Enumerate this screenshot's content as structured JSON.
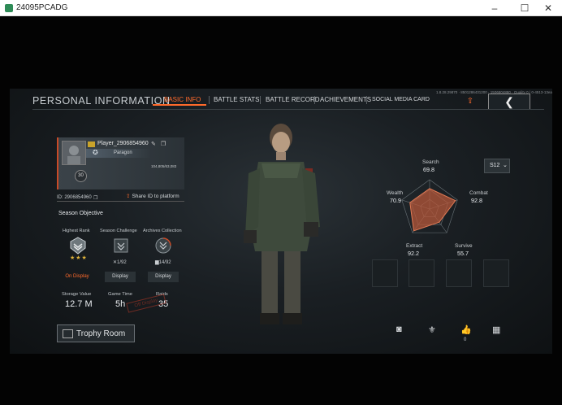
{
  "window": {
    "title": "24095PCADG",
    "minimize": "–",
    "maximize": "☐",
    "close": "✕"
  },
  "header": {
    "title": "PERSONAL INFORMATION",
    "tabs": [
      {
        "label": "BASIC INFO",
        "active": true
      },
      {
        "label": "BATTLE STATS",
        "active": false
      },
      {
        "label": "BATTLE RECORD",
        "active": false
      },
      {
        "label": "ACHIEVEMENTS",
        "active": false
      },
      {
        "label": "SOCIAL MEDIA CARD",
        "active": false
      }
    ],
    "version": "1.8.28.29870 · 8501286431200 · 1506804880 · Quality 0 / 0-4513-13ea",
    "back_glyph": "❮",
    "share_glyph": "⇪"
  },
  "profile": {
    "avatar_level": "30",
    "player_name": "Player_2906854960",
    "rank": "Paragon",
    "card_id": "104,805/63,083",
    "id_label": "ID:",
    "id_value": "2906854960",
    "share_id_label": "Share ID to platform"
  },
  "season_objective": {
    "title": "Season Objective",
    "items": [
      {
        "label": "Highest Rank",
        "count": "",
        "button": "On Display",
        "on": true
      },
      {
        "label": "Season Challenge",
        "count": "1/92",
        "button": "Display",
        "on": false
      },
      {
        "label": "Archives Collection",
        "count": "14/92",
        "button": "Display",
        "on": false
      }
    ],
    "stars": "★★★"
  },
  "stats": [
    {
      "label": "Storage Value",
      "value": "12.7 M"
    },
    {
      "label": "Game Time",
      "value": "5h"
    },
    {
      "label": "Raids",
      "value": "35"
    }
  ],
  "stamp_text": "Off Display",
  "trophy_room": {
    "label": "Trophy Room"
  },
  "season_select": {
    "value": "S12",
    "chevron": "⌄"
  },
  "radar": {
    "stats": [
      {
        "label": "Search",
        "value": "69.8"
      },
      {
        "label": "Combat",
        "value": "92.8"
      },
      {
        "label": "Survive",
        "value": "55.7"
      },
      {
        "label": "Extract",
        "value": "92.2"
      },
      {
        "label": "Wealth",
        "value": "70.9"
      }
    ],
    "colors": {
      "fill": "#b5573a",
      "stroke": "#e07a55",
      "grid": "#6a7378"
    }
  },
  "actions": {
    "likes": "0",
    "icons": [
      "camera-icon",
      "emblem-icon",
      "thumbs-up-icon",
      "grid-icon"
    ]
  },
  "colors": {
    "accent": "#ff6a2b",
    "gold": "#c9a32a"
  }
}
